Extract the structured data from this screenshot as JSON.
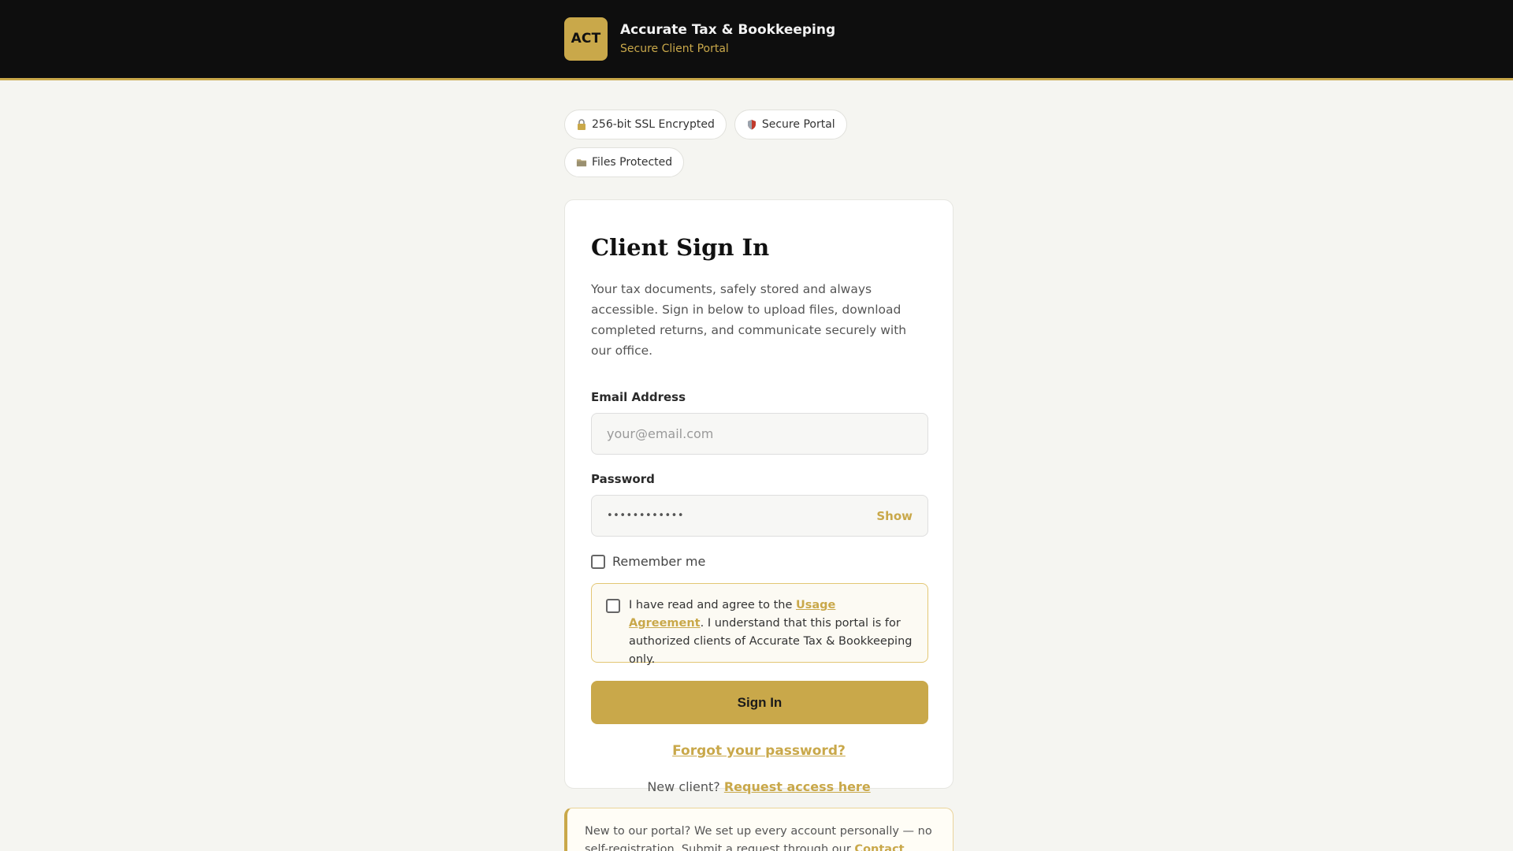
{
  "header": {
    "logo_text": "ACT",
    "brand_name": "Accurate Tax & Bookkeeping",
    "brand_subtitle": "Secure Client Portal"
  },
  "badges": [
    {
      "icon": "lock-icon",
      "label": "256-bit SSL Encrypted"
    },
    {
      "icon": "shield-icon",
      "label": "Secure Portal"
    },
    {
      "icon": "folder-icon",
      "label": "Files Protected"
    }
  ],
  "signin_card": {
    "title": "Client Sign In",
    "description": "Your tax documents, safely stored and always accessible. Sign in below to upload files, download completed returns, and communicate securely with our office.",
    "email_label": "Email Address",
    "email_placeholder": "your@email.com",
    "email_value": "",
    "password_label": "Password",
    "password_value": "••••••••••••",
    "show_label": "Show",
    "remember_label": "Remember me",
    "remember_checked": false,
    "agreement_prefix": "I have read and agree to the ",
    "agreement_link": "Usage Agreement",
    "agreement_suffix": ". I understand that this portal is for authorized clients of Accurate Tax & Bookkeeping only.",
    "agreement_checked": false,
    "signin_button": "Sign In",
    "forgot_link": "Forgot your password?",
    "new_client_prefix": "New client? ",
    "request_access_link": "Request access here"
  },
  "notice": {
    "text": "New to our portal? We set up every account personally — no self-registration. Submit a request through our ",
    "link": "Contact page"
  },
  "colors": {
    "accent": "#c9a84a",
    "header_bg": "#0e0e0e",
    "page_bg": "#f5f5f1"
  }
}
